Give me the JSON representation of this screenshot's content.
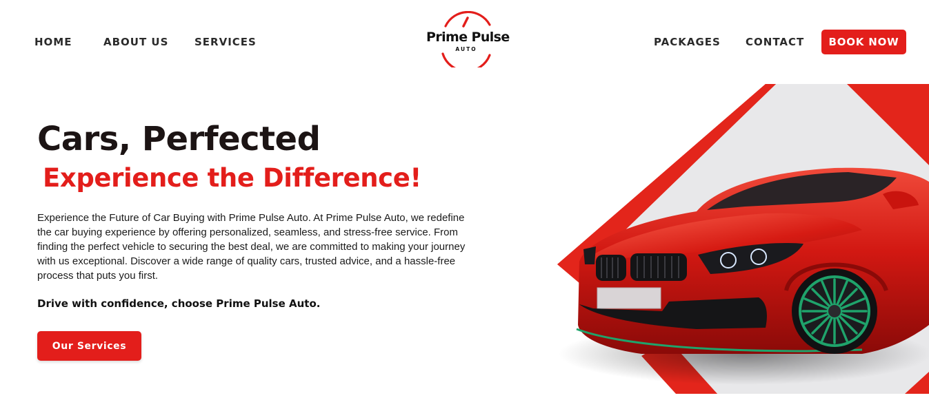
{
  "nav": {
    "left_links": [
      {
        "label": "HOME"
      },
      {
        "label": "ABOUT US"
      },
      {
        "label": "SERVICES"
      }
    ],
    "right_links": [
      {
        "label": "PACKAGES"
      },
      {
        "label": "CONTACT"
      }
    ],
    "cta_label": "BOOK NOW"
  },
  "logo": {
    "name": "Prime Pulse",
    "sub": "AUTO",
    "icon": "speedometer-ring-icon"
  },
  "hero": {
    "title": "Cars, Perfected",
    "subtitle": "Experience the Difference!",
    "description": "Experience the Future of Car Buying with Prime Pulse Auto. At Prime Pulse Auto, we redefine the car buying experience by offering personalized, seamless, and stress-free service. From finding the perfect vehicle to securing the best deal, we are committed to making your journey with us exceptional. Discover a wide range of quality cars, trusted advice, and a hassle-free process that puts you first.",
    "tagline": "Drive with confidence, choose Prime Pulse Auto.",
    "button_label": "Our Services",
    "image": "red-sports-car-illustration"
  },
  "colors": {
    "accent": "#e31e1b",
    "text_dark": "#1c1414",
    "panel_gray": "#e8e8ea",
    "rim_green": "#1fa36b"
  }
}
